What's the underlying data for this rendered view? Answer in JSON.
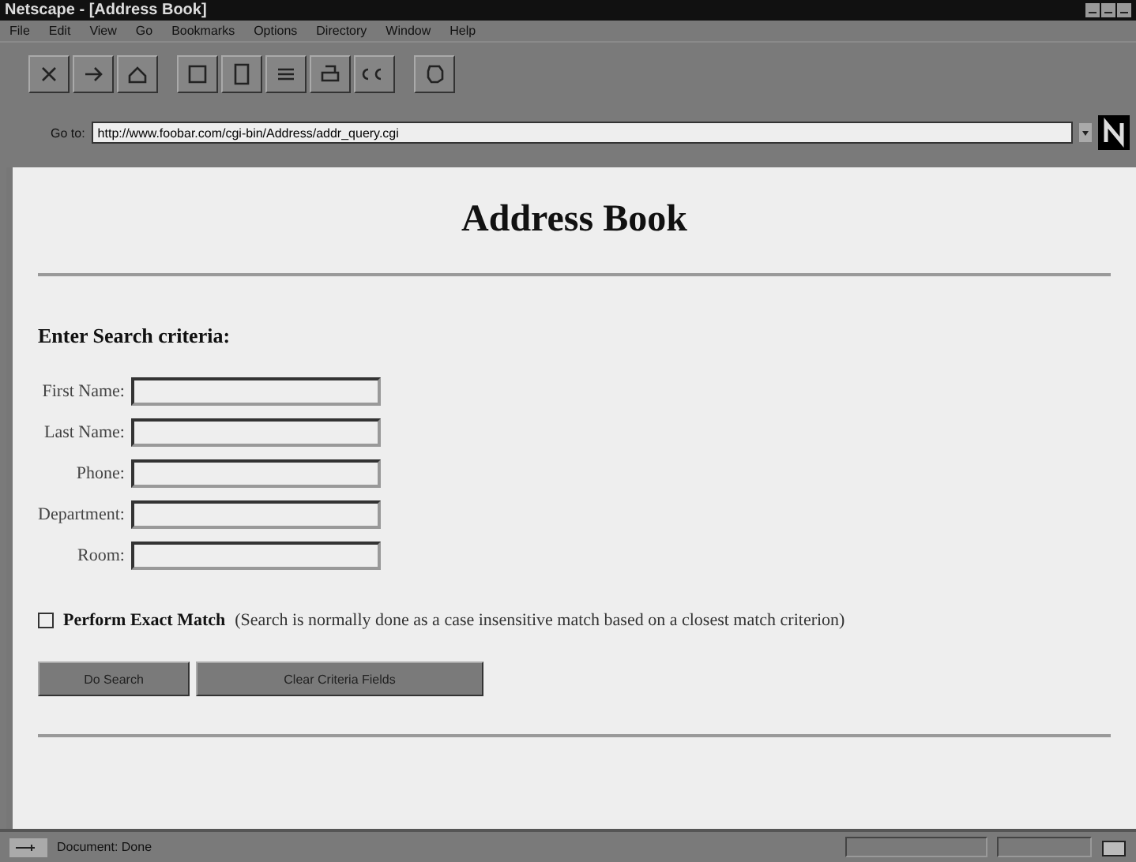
{
  "window": {
    "title": "Netscape - [Address Book]"
  },
  "menu": [
    "File",
    "Edit",
    "View",
    "Go",
    "Bookmarks",
    "Options",
    "Directory",
    "Window",
    "Help"
  ],
  "location": {
    "label": "Go to:",
    "url": "http://www.foobar.com/cgi-bin/Address/addr_query.cgi"
  },
  "page": {
    "heading": "Address Book",
    "subheading": "Enter Search criteria:",
    "fields": [
      {
        "label": "First Name:"
      },
      {
        "label": "Last Name:"
      },
      {
        "label": "Phone:"
      },
      {
        "label": "Department:"
      },
      {
        "label": "Room:"
      }
    ],
    "exact_match": {
      "label": "Perform Exact Match",
      "note": "(Search is normally done as a case insensitive match based on a closest match criterion)",
      "checked": false
    },
    "buttons": [
      "Do Search",
      "Clear Criteria Fields"
    ]
  },
  "status_bar": {
    "text": "Document: Done"
  }
}
